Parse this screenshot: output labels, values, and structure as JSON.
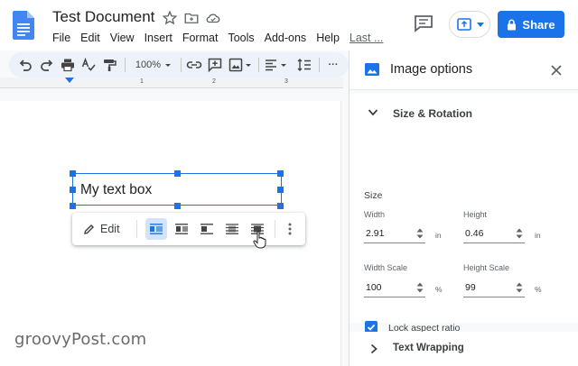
{
  "header": {
    "title": "Test Document",
    "menu": [
      "File",
      "Edit",
      "View",
      "Insert",
      "Format",
      "Tools",
      "Add-ons",
      "Help"
    ],
    "last_edit": "Last ...",
    "share_label": "Share"
  },
  "toolbar": {
    "zoom": "100%",
    "more": "···"
  },
  "ruler": {
    "labels": [
      "1",
      "2",
      "3"
    ]
  },
  "document": {
    "text_box": "My text box"
  },
  "image_toolbar": {
    "edit_label": "Edit"
  },
  "panel": {
    "title": "Image options",
    "size_rotation": {
      "title": "Size & Rotation",
      "size_label": "Size",
      "width_label": "Width",
      "width_value": "2.91",
      "width_unit": "in",
      "height_label": "Height",
      "height_value": "0.46",
      "height_unit": "in",
      "width_scale_label": "Width Scale",
      "width_scale_value": "100",
      "width_scale_unit": "%",
      "height_scale_label": "Height Scale",
      "height_scale_value": "99",
      "height_scale_unit": "%",
      "lock_label": "Lock aspect ratio"
    },
    "text_wrapping": {
      "title": "Text Wrapping"
    }
  },
  "watermark": "groovyPost.com",
  "colors": {
    "accent": "#1a73e8",
    "doc_blue": "#4285f4"
  }
}
